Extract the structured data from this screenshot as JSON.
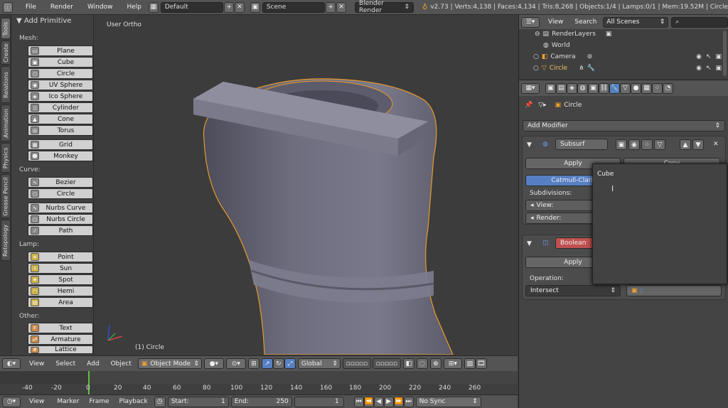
{
  "topbar": {
    "menus": [
      "File",
      "Render",
      "Window",
      "Help"
    ],
    "layout": "Default",
    "scene": "Scene",
    "engine": "Blender Render",
    "stats": "v2.73 | Verts:4,138 | Faces:4,134 | Tris:8,268 | Objects:1/4 | Lamps:0/1 | Mem:19.52M | Circle"
  },
  "side_tabs": [
    "Tools",
    "Create",
    "Relations",
    "Animation",
    "Physics",
    "Grease Pencil",
    "Retopology"
  ],
  "shelf": {
    "title": "Add Primitive",
    "mesh_label": "Mesh:",
    "mesh": [
      "Plane",
      "Cube",
      "Circle",
      "UV Sphere",
      "Ico Sphere",
      "Cylinder",
      "Cone",
      "Torus",
      "Grid",
      "Monkey"
    ],
    "curve_label": "Curve:",
    "curve": [
      "Bezier",
      "Circle",
      "Nurbs Curve",
      "Nurbs Circle",
      "Path"
    ],
    "lamp_label": "Lamp:",
    "lamp": [
      "Point",
      "Sun",
      "Spot",
      "Hemi",
      "Area"
    ],
    "other_label": "Other:",
    "other": [
      "Text",
      "Armature",
      "Lattice"
    ]
  },
  "viewport": {
    "view_name": "User Ortho",
    "object_label": "(1) Circle"
  },
  "viewport_header": {
    "menus": [
      "View",
      "Select",
      "Add",
      "Object"
    ],
    "mode": "Object Mode",
    "orientation": "Global"
  },
  "timeline": {
    "ticks": [
      "-40",
      "-20",
      "0",
      "20",
      "40",
      "60",
      "80",
      "100",
      "120",
      "140",
      "160",
      "180",
      "200",
      "220",
      "240",
      "260"
    ],
    "current_frame": 0,
    "menus": [
      "View",
      "Marker",
      "Frame",
      "Playback"
    ],
    "start_label": "Start:",
    "start": "1",
    "end_label": "End:",
    "end": "250",
    "frame": "1",
    "sync": "No Sync"
  },
  "outliner": {
    "menus": [
      "View",
      "Search"
    ],
    "scenes": "All Scenes",
    "rows": [
      "RenderLayers",
      "World",
      "Camera",
      "Circle"
    ]
  },
  "properties": {
    "object": "Circle",
    "add_modifier": "Add Modifier",
    "mod1": {
      "name": "Subsurf",
      "apply": "Apply",
      "copy": "Copy",
      "type": "Catmull-Clark",
      "subdivisions": "Subdivisions:",
      "view": "View:",
      "render": "Render:"
    },
    "mod2": {
      "name": "Boolean",
      "apply": "Apply",
      "operation_label": "Operation:",
      "operation": "Intersect"
    }
  },
  "tooltip": {
    "text": "Cube"
  },
  "colors": {
    "accent_blue": "#5680c2",
    "selection_orange": "#f0a030",
    "boolean_red": "#c05050"
  }
}
